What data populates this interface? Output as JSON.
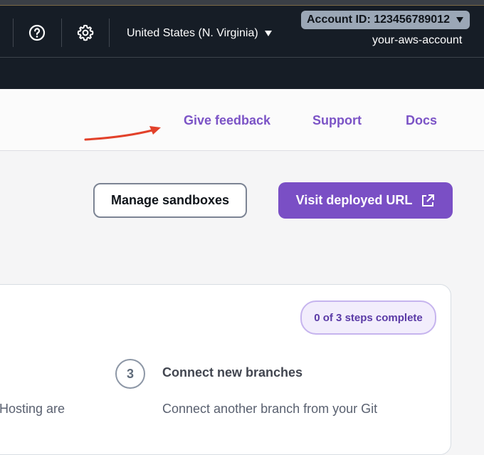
{
  "header": {
    "region_label": "United States (N. Virginia)",
    "account_id_label": "Account ID: 123456789012",
    "account_name": "your-aws-account",
    "icons": [
      "help-icon",
      "settings-icon",
      "caret-down-icon"
    ]
  },
  "helpbar": {
    "links": [
      "Give feedback",
      "Support",
      "Docs"
    ]
  },
  "actions": {
    "manage_sandboxes": "Manage sandboxes",
    "visit_deployed_url": "Visit deployed URL"
  },
  "card": {
    "steps_badge": "0 of 3 steps complete",
    "step": {
      "number": "3",
      "title": "Connect new branches",
      "description": "Connect another branch from your Git"
    },
    "left_text_fragment": "Hosting are"
  },
  "colors": {
    "nav_bg": "#161d26",
    "accent": "#7a4fc5",
    "link": "#7b53c6",
    "annotation_arrow": "#e2412a"
  }
}
